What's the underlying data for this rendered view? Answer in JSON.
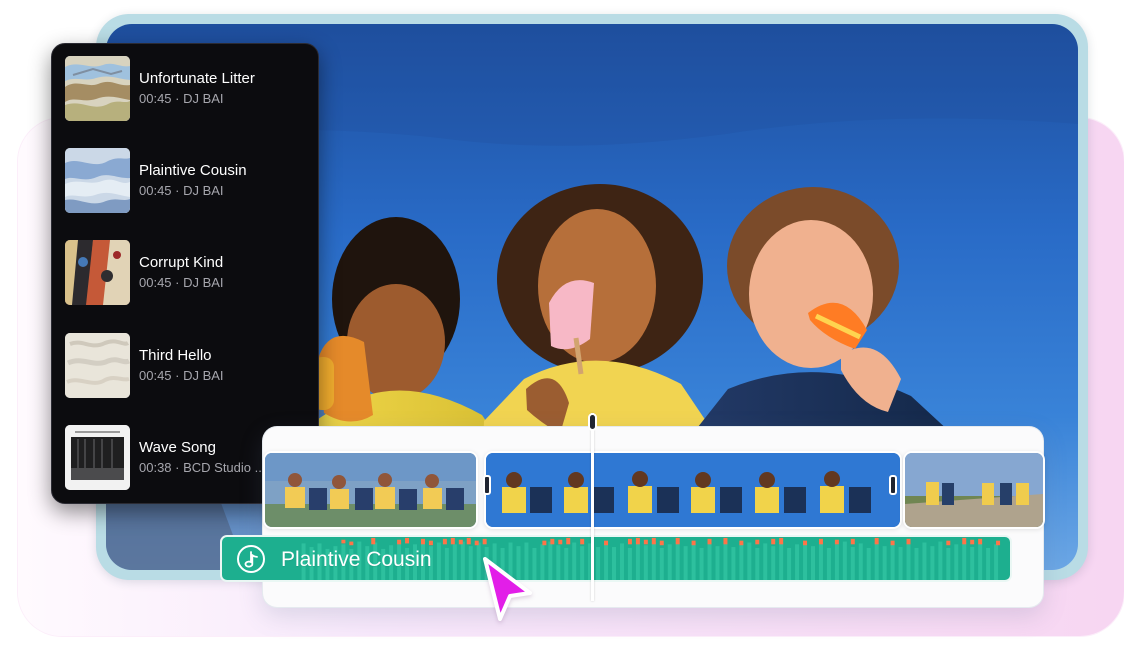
{
  "playlist": {
    "tracks": [
      {
        "title": "Unfortunate Litter",
        "meta": "00:45 · DJ BAI"
      },
      {
        "title": "Plaintive Cousin",
        "meta": "00:45 · DJ BAI"
      },
      {
        "title": "Corrupt Kind",
        "meta": "00:45 · DJ BAI"
      },
      {
        "title": "Third Hello",
        "meta": "00:45 · DJ BAI"
      },
      {
        "title": "Wave Song",
        "meta": "00:38 · BCD Studio ..."
      }
    ]
  },
  "timeline": {
    "audio_label": "Plaintive Cousin"
  },
  "colors": {
    "accent_pink": "#e21ee8",
    "audio_green": "#1daf8f",
    "waveform_orange": "#ff7448"
  },
  "icons": {
    "audio": "music-note-icon",
    "cursor": "pointer-cursor-icon"
  }
}
